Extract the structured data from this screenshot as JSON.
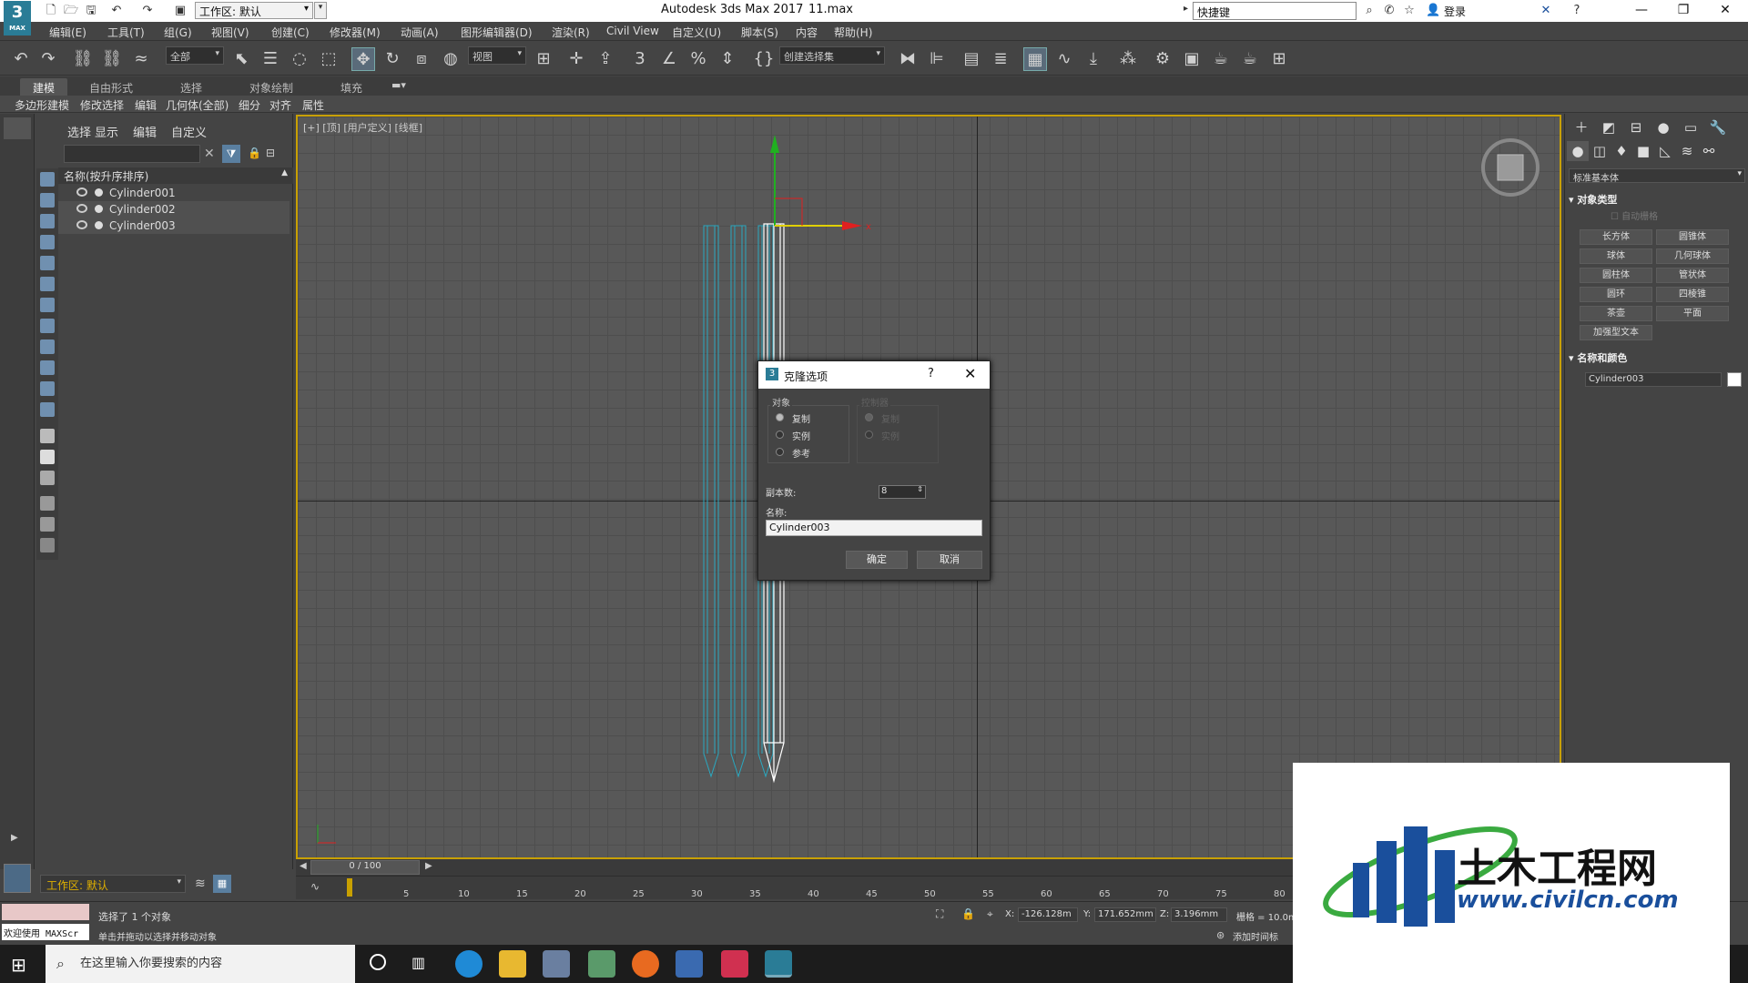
{
  "window": {
    "app_title": "Autodesk 3ds Max 2017",
    "file_name": "11.max",
    "workspace": "工作区: 默认",
    "search_placeholder": "快捷键",
    "login": "登录"
  },
  "menu": [
    "编辑(E)",
    "工具(T)",
    "组(G)",
    "视图(V)",
    "创建(C)",
    "修改器(M)",
    "动画(A)",
    "图形编辑器(D)",
    "渲染(R)",
    "Civil View",
    "自定义(U)",
    "脚本(S)",
    "内容",
    "帮助(H)"
  ],
  "toolbar": {
    "selection_filter": "全部",
    "reference_coord": "视图",
    "named_selection": "创建选择集"
  },
  "ribbon": {
    "tabs": [
      "建模",
      "自由形式",
      "选择",
      "对象绘制",
      "填充"
    ],
    "sub_items": [
      "多边形建模",
      "修改选择",
      "编辑",
      "几何体(全部)",
      "细分",
      "对齐",
      "属性"
    ]
  },
  "explorer": {
    "menus": [
      "选择",
      "显示",
      "编辑",
      "自定义"
    ],
    "column_header": "名称(按升序排序)",
    "items": [
      "Cylinder001",
      "Cylinder002",
      "Cylinder003"
    ],
    "workspace": "工作区: 默认"
  },
  "viewport": {
    "label": "[+] [顶] [用户定义] [线框]"
  },
  "dialog": {
    "title": "克隆选项",
    "help": "?",
    "object_group": "对象",
    "object_options": [
      "复制",
      "实例",
      "参考"
    ],
    "object_selected": "复制",
    "controller_group": "控制器",
    "controller_options": [
      "复制",
      "实例"
    ],
    "copies_label": "副本数:",
    "copies_value": "8",
    "name_label": "名称:",
    "name_value": "Cylinder003",
    "ok": "确定",
    "cancel": "取消"
  },
  "command_panel": {
    "category": "标准基本体",
    "object_type_title": "对象类型",
    "autogrid": "自动栅格",
    "buttons": [
      "长方体",
      "圆锥体",
      "球体",
      "几何球体",
      "圆柱体",
      "管状体",
      "圆环",
      "四棱锥",
      "茶壶",
      "平面",
      "加强型文本"
    ],
    "name_color_title": "名称和颜色",
    "object_name": "Cylinder003",
    "object_color": "#ffffff"
  },
  "timeline": {
    "frame_display": "0 / 100",
    "ticks": [
      "5",
      "10",
      "15",
      "20",
      "25",
      "30",
      "35",
      "40",
      "45",
      "50",
      "55",
      "60",
      "65",
      "70",
      "75",
      "80"
    ]
  },
  "status": {
    "selection_msg": "选择了 1 个对象",
    "prompt_msg": "单击并拖动以选择并移动对象",
    "welcome": "欢迎使用 MAXScr",
    "x_label": "X:",
    "x": "-126.128m",
    "y_label": "Y:",
    "y": "171.652mm",
    "z_label": "Z:",
    "z": "3.196mm",
    "grid": "栅格 = 10.0m",
    "add_time_tag": "添加时间标"
  },
  "taskbar": {
    "search_placeholder": "在这里输入你要搜索的内容"
  },
  "watermark": {
    "title": "土木工程网",
    "url": "www.civilcn.com"
  },
  "colors": {
    "viewport_border": "#c8a000",
    "selected_wire": "#ffffff",
    "clone_wire": "#2aa8c0",
    "x_axis": "#e02020",
    "y_axis": "#20b020",
    "logo_blue": "#1a4f9c"
  }
}
